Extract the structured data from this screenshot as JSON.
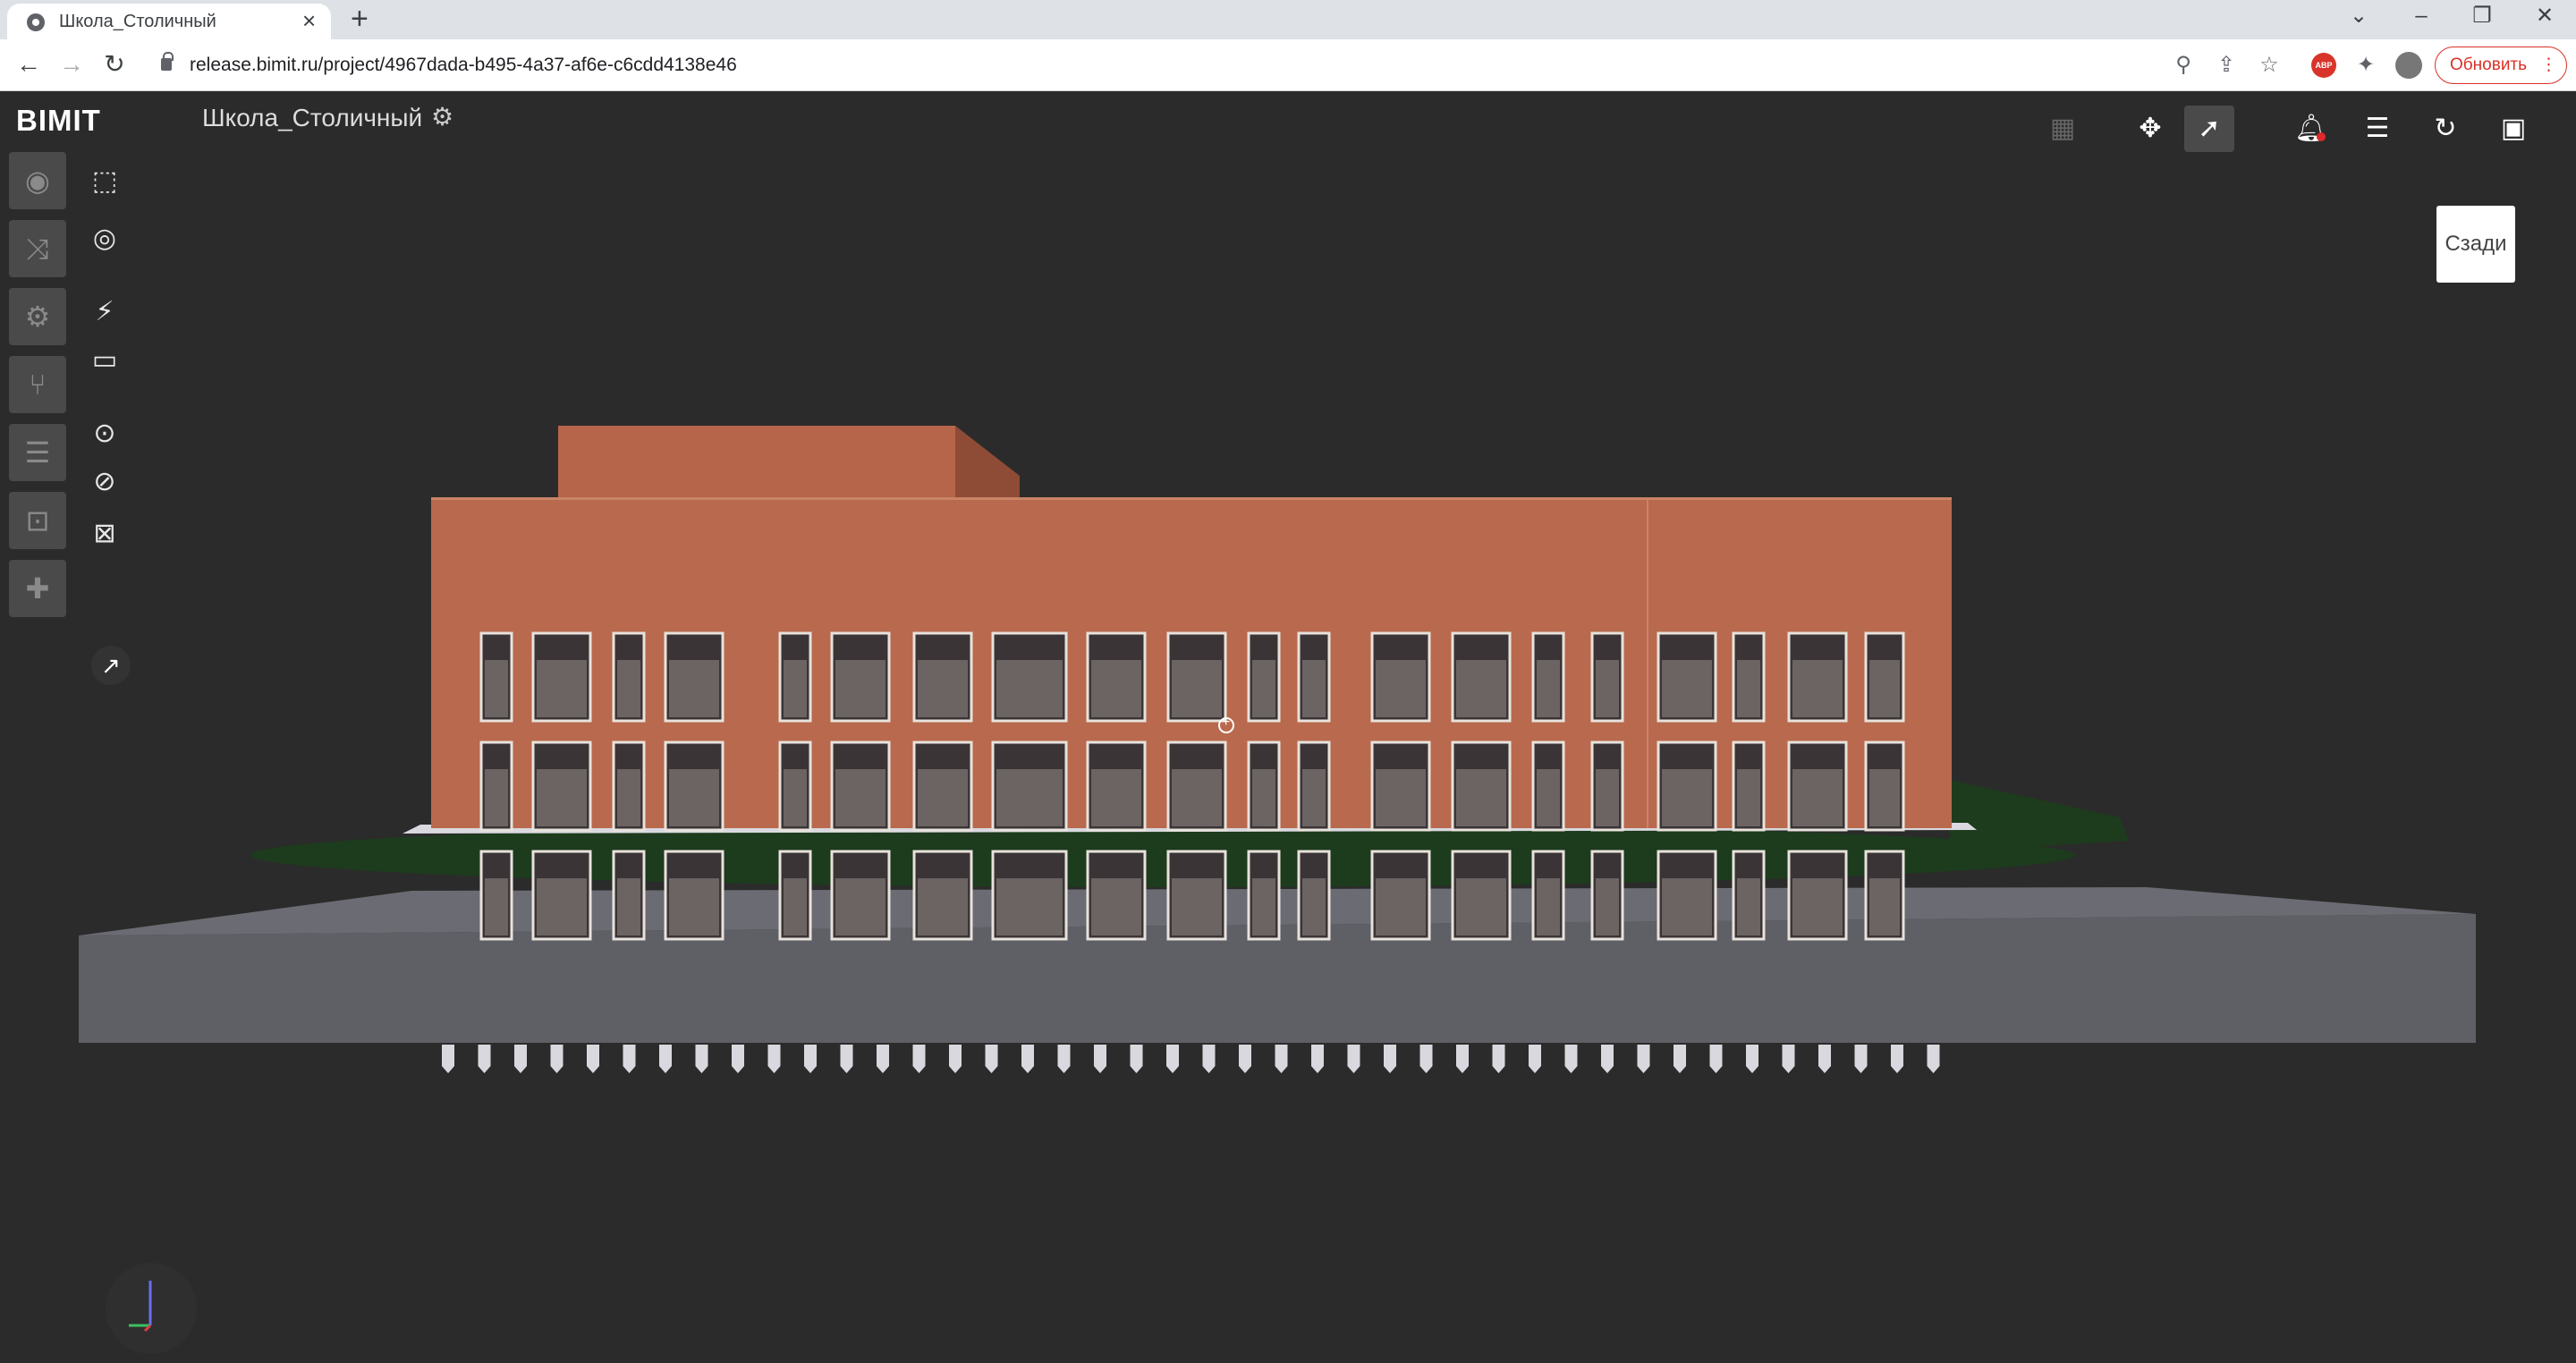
{
  "browser": {
    "tab_title": "Школа_Столичный",
    "tab_close": "×",
    "new_tab": "+",
    "url": "release.bimit.ru/project/4967dada-b495-4a37-af6e-c6cdd4138e46",
    "update_label": "Обновить",
    "extension_abp": "ABP"
  },
  "app": {
    "logo": "BIMIT",
    "project_title": "Школа_Столичный",
    "view_cube_label": "Сзади"
  },
  "sidebar": {
    "items": [
      {
        "icon": "eye-icon"
      },
      {
        "icon": "shuffle-icon"
      },
      {
        "icon": "settings-icon"
      },
      {
        "icon": "branch-icon"
      },
      {
        "icon": "list-icon"
      },
      {
        "icon": "contact-card-icon"
      },
      {
        "icon": "puzzle-icon"
      }
    ]
  },
  "tools": [
    {
      "icon": "fit-view-icon"
    },
    {
      "icon": "target-icon"
    },
    {
      "icon": "section-plane-icon"
    },
    {
      "icon": "section-level-icon"
    },
    {
      "icon": "show-selected-icon"
    },
    {
      "icon": "hide-selected-icon"
    },
    {
      "icon": "clear-selection-icon"
    }
  ],
  "topbar": {
    "icons": [
      "qr-grid-icon",
      "orbit-icon",
      "select-arrow-icon",
      "bell-icon",
      "menu-list-icon",
      "refresh-icon",
      "account-icon"
    ]
  },
  "colors": {
    "app_background": "#2b2b2b",
    "brick_facade": "#b9694d",
    "lawn": "#1d3b1d",
    "ground_slab": "#5f5f66",
    "update_button": "#d93025"
  }
}
